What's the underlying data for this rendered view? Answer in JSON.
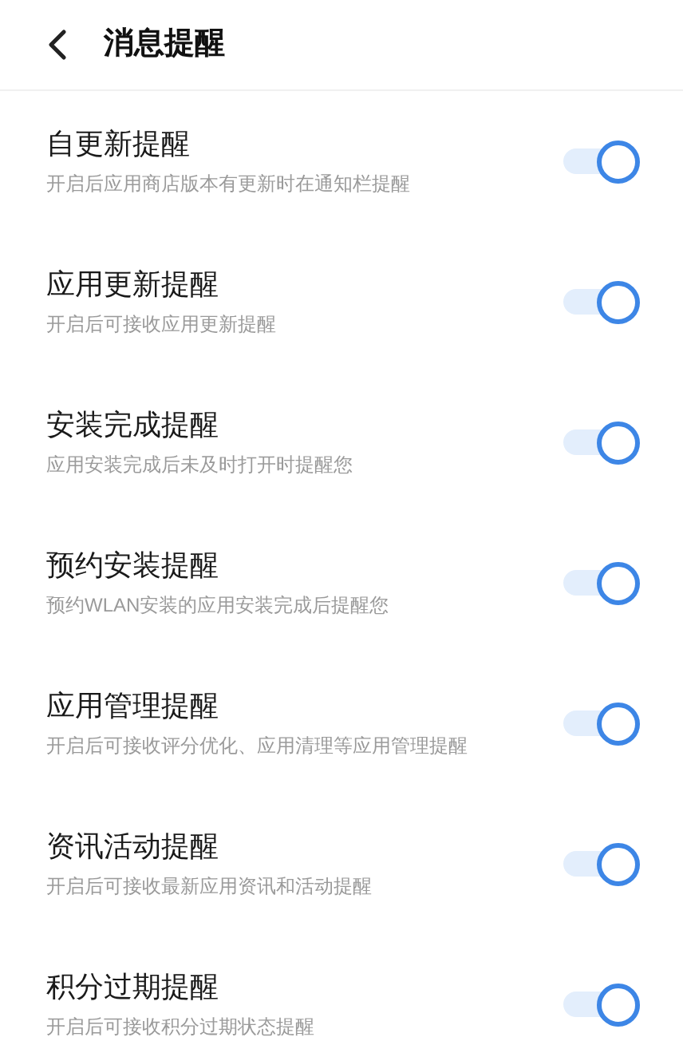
{
  "header": {
    "title": "消息提醒"
  },
  "settings": [
    {
      "title": "自更新提醒",
      "description": "开启后应用商店版本有更新时在通知栏提醒",
      "on": true
    },
    {
      "title": "应用更新提醒",
      "description": "开启后可接收应用更新提醒",
      "on": true
    },
    {
      "title": "安装完成提醒",
      "description": "应用安装完成后未及时打开时提醒您",
      "on": true
    },
    {
      "title": "预约安装提醒",
      "description": "预约WLAN安装的应用安装完成后提醒您",
      "on": true
    },
    {
      "title": "应用管理提醒",
      "description": "开启后可接收评分优化、应用清理等应用管理提醒",
      "on": true
    },
    {
      "title": "资讯活动提醒",
      "description": "开启后可接收最新应用资讯和活动提醒",
      "on": true
    },
    {
      "title": "积分过期提醒",
      "description": "开启后可接收积分过期状态提醒",
      "on": true
    }
  ]
}
